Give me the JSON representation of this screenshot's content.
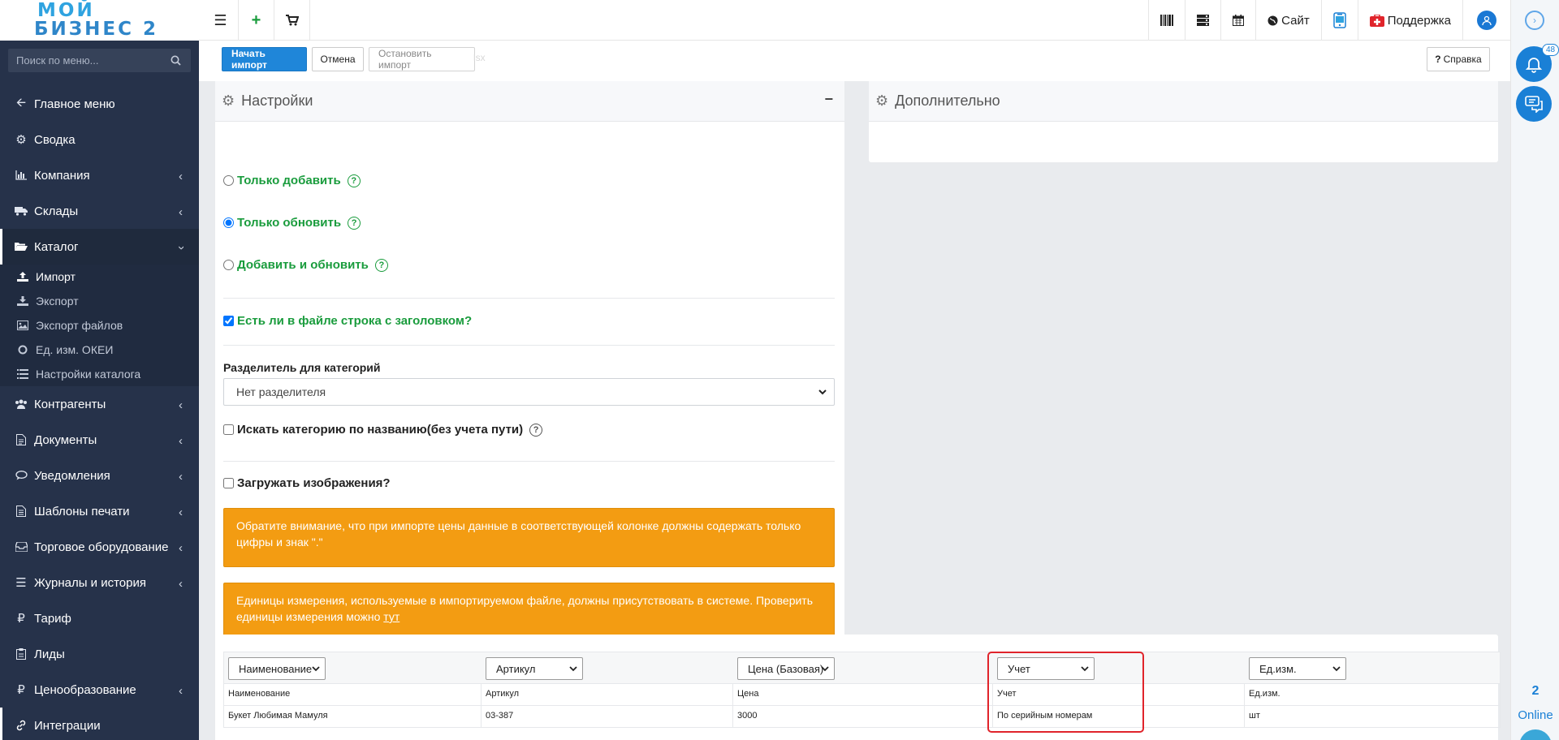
{
  "logo": {
    "line1": "МОЙ",
    "line2": "БИЗНЕС 2"
  },
  "topbar": {
    "site_label": "Сайт",
    "support_label": "Поддержка"
  },
  "sidebar": {
    "search_placeholder": "Поиск по меню...",
    "items": [
      {
        "label": "Главное меню",
        "icon": "arrow-left-icon"
      },
      {
        "label": "Сводка",
        "icon": "gear-icon"
      },
      {
        "label": "Компания",
        "icon": "bar-chart-icon"
      },
      {
        "label": "Склады",
        "icon": "truck-icon"
      },
      {
        "label": "Каталог",
        "icon": "folder-open-icon"
      }
    ],
    "catalog_sub": [
      {
        "label": "Импорт",
        "icon": "upload-icon"
      },
      {
        "label": "Экспорт",
        "icon": "download-icon"
      },
      {
        "label": "Экспорт файлов",
        "icon": "image-icon"
      },
      {
        "label": "Ед. изм. ОКЕИ",
        "icon": "circle-icon"
      },
      {
        "label": "Настройки каталога",
        "icon": "list-icon"
      }
    ],
    "items_after": [
      {
        "label": "Контрагенты",
        "icon": "users-icon"
      },
      {
        "label": "Документы",
        "icon": "document-icon"
      },
      {
        "label": "Уведомления",
        "icon": "chat-icon"
      },
      {
        "label": "Шаблоны печати",
        "icon": "print-template-icon"
      },
      {
        "label": "Торговое оборудование",
        "icon": "inbox-icon"
      },
      {
        "label": "Журналы и история",
        "icon": "menu-icon"
      },
      {
        "label": "Тариф",
        "icon": "ruble-icon"
      },
      {
        "label": "Лиды",
        "icon": "clipboard-icon"
      },
      {
        "label": "Ценообразование",
        "icon": "ruble-icon"
      },
      {
        "label": "Интеграции",
        "icon": "link-icon"
      }
    ]
  },
  "toolbar": {
    "start_import": "Начать импорт",
    "cancel": "Отмена",
    "stop_import": "Остановить импорт",
    "faint": "lsx",
    "help": "Справка"
  },
  "settings": {
    "title": "Настройки",
    "collapse": "−",
    "only_add": "Только добавить",
    "only_update": "Только обновить",
    "add_and_update": "Добавить и обновить",
    "header_row": "Есть ли в файле строка с заголовком?",
    "category_separator_label": "Разделитель для категорий",
    "category_separator_value": "Нет разделителя",
    "search_category": "Искать категорию по названию(без учета пути)",
    "load_images": "Загружать изображения?",
    "alert1": "Обратите внимание, что при импорте цены данные в соответствующей колонке должны содержать только цифры и знак \".\"",
    "alert2_text": "Единицы измерения, используемые в импортируемом файле, должны присутствовать в системе. Проверить единицы измерения можно",
    "alert2_link": "тут"
  },
  "additional": {
    "title": "Дополнительно"
  },
  "table": {
    "column_selects": [
      "Наименование",
      "Артикул",
      "Цена (Базовая)",
      "Учет",
      "Ед.изм."
    ],
    "header_row": [
      "Наименование",
      "Артикул",
      "Цена",
      "Учет",
      "Ед.изм."
    ],
    "data_row": [
      "Букет Любимая Мамуля",
      "03-387",
      "3000",
      "По серийным номерам",
      "шт"
    ]
  },
  "right_rail": {
    "notif_count": "48",
    "online_count": "2",
    "online_label": "Online"
  }
}
